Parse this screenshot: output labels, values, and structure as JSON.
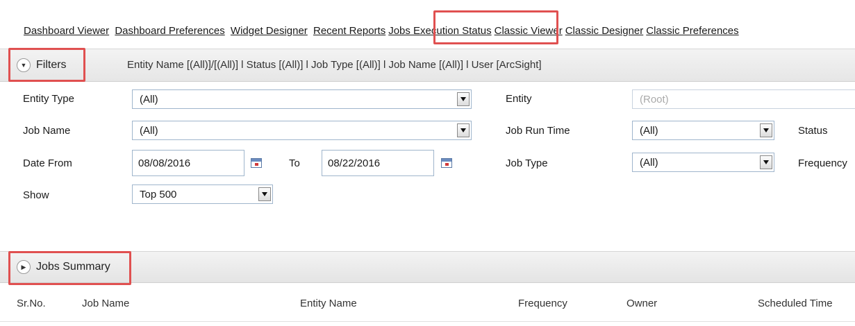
{
  "nav": {
    "links": [
      "Dashboard Viewer",
      "Dashboard Preferences",
      "Widget Designer",
      "Recent Reports",
      "Jobs Execution Status",
      "Classic Viewer",
      "Classic Designer",
      "Classic Preferences"
    ],
    "active_link": "Jobs Execution Status"
  },
  "filters": {
    "toggle_label": "Filters",
    "summary": "Entity Name [(All)]/[(All)] l  Status [(All)] l  Job Type [(All)] l  Job Name [(All)]  l User [ArcSight]",
    "entity_type": {
      "label": "Entity Type",
      "value": "(All)"
    },
    "entity": {
      "label": "Entity",
      "value": "(Root)"
    },
    "job_name": {
      "label": "Job Name",
      "value": "(All)"
    },
    "job_run_time": {
      "label": "Job Run Time",
      "value": "(All)"
    },
    "status": {
      "label": "Status"
    },
    "date_from": {
      "label": "Date From",
      "value": "08/08/2016"
    },
    "date_to": {
      "label": "To",
      "value": "08/22/2016"
    },
    "job_type": {
      "label": "Job Type",
      "value": "(All)"
    },
    "frequency": {
      "label": "Frequency"
    },
    "show": {
      "label": "Show",
      "value": "Top 500"
    }
  },
  "jobs_summary": {
    "toggle_label": "Jobs Summary",
    "columns": [
      "Sr.No.",
      "Job Name",
      "Entity Name",
      "Frequency",
      "Owner",
      "Scheduled Time"
    ]
  },
  "colors": {
    "highlight": "#e05050",
    "input_border": "#9fb5cc",
    "bar_bg": "#ececec"
  },
  "icons": [
    "chevron-down-circle-icon",
    "chevron-right-circle-icon",
    "calendar-icon",
    "dropdown-arrow-icon"
  ]
}
